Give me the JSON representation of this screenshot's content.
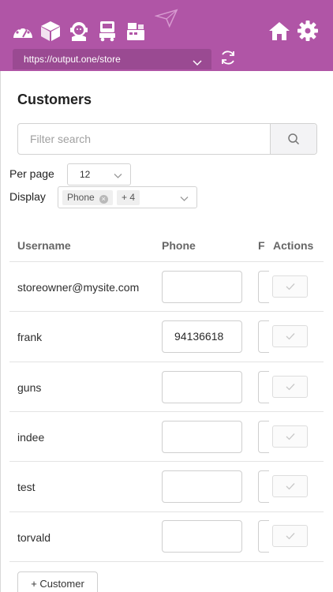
{
  "nav": {
    "icons": [
      "dashboard-icon",
      "package-icon",
      "support-agent-icon",
      "truck-icon",
      "cash-register-icon"
    ],
    "send_icon": "paper-plane-icon",
    "home_icon": "home-icon",
    "settings_icon": "gear-icon"
  },
  "url_bar": {
    "value": "https://output.one/store"
  },
  "page": {
    "title": "Customers"
  },
  "search": {
    "placeholder": "Filter search"
  },
  "per_page": {
    "label": "Per page",
    "value": "12"
  },
  "display": {
    "label": "Display",
    "tags": [
      "Phone",
      "+ 4"
    ]
  },
  "table": {
    "headers": {
      "username": "Username",
      "phone": "Phone",
      "f": "F",
      "actions": "Actions"
    },
    "rows": [
      {
        "username": "storeowner@mysite.com",
        "phone": ""
      },
      {
        "username": "frank",
        "phone": "94136618"
      },
      {
        "username": "guns",
        "phone": ""
      },
      {
        "username": "indee",
        "phone": ""
      },
      {
        "username": "test",
        "phone": ""
      },
      {
        "username": "torvald",
        "phone": ""
      }
    ]
  },
  "add_button": {
    "label": "+ Customer"
  },
  "colors": {
    "brand": "#b055a6",
    "url_bar": "#9a4a92"
  }
}
